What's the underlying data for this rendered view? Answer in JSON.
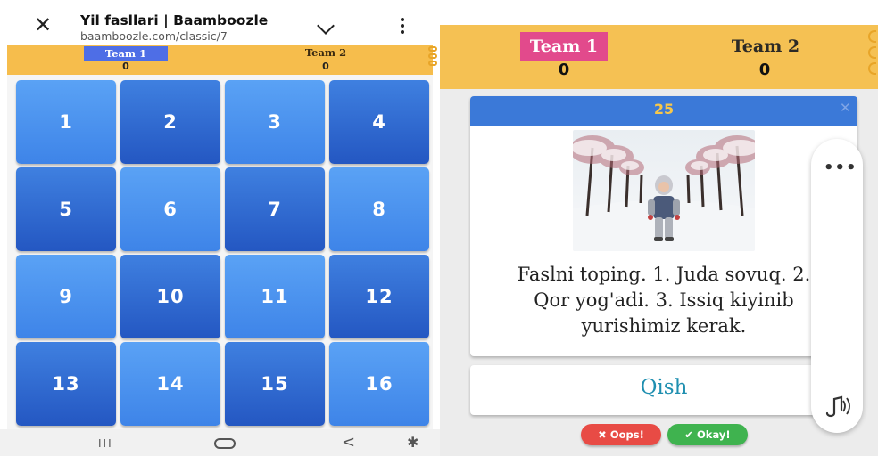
{
  "browser": {
    "title": "Yil fasllari | Baamboozle",
    "url": "baamboozle.com/classic/7"
  },
  "left_scoreboard": {
    "team1": {
      "name": "Team 1",
      "score": "0"
    },
    "team2": {
      "name": "Team 2",
      "score": "0"
    }
  },
  "grid": {
    "tiles": [
      "1",
      "2",
      "3",
      "4",
      "5",
      "6",
      "7",
      "8",
      "9",
      "10",
      "11",
      "12",
      "13",
      "14",
      "15",
      "16"
    ],
    "tile_colors": {
      "light": "#4f95f0",
      "dark": "#2d68d0"
    }
  },
  "android_nav": {
    "recents": "III",
    "back": "<",
    "accessibility": "✱"
  },
  "right_scoreboard": {
    "team1": {
      "name": "Team 1",
      "score": "0",
      "color": "#e24a8c"
    },
    "team2": {
      "name": "Team 2",
      "score": "0"
    }
  },
  "question": {
    "points": "25",
    "text_line1": "Faslni toping. 1. Juda sovuq. 2.",
    "text_line2": "Qor yog'adi. 3. Issiq kiyinib",
    "text_line3": "yurishimiz kerak.",
    "answer": "Qish"
  },
  "buttons": {
    "oops": "Oops!",
    "okay": "Okay!"
  },
  "colors": {
    "header_orange": "#f5c153",
    "card_header_blue": "#3b79d8",
    "answer_teal": "#1f8fb0",
    "oops_red": "#e84b45",
    "okay_green": "#3fb34f"
  }
}
